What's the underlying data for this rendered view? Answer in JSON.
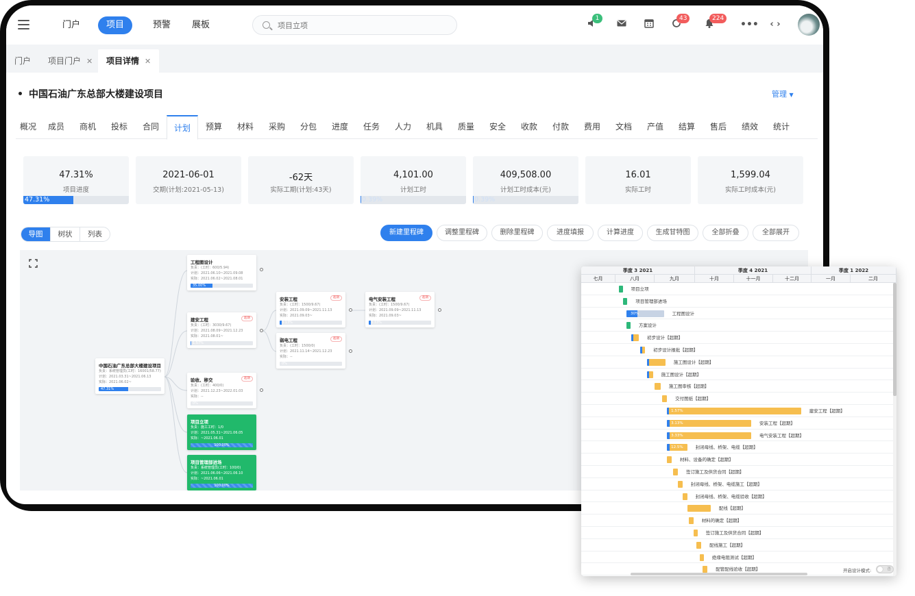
{
  "topbar": {
    "nav": [
      "门户",
      "项目",
      "预警",
      "展板"
    ],
    "search_placeholder": "项目立项",
    "badges": {
      "notice": "1",
      "sync": "43",
      "bell": "224"
    },
    "more_icon": "more-icon",
    "code_icon": "code-icon"
  },
  "page_tabs": [
    {
      "label": "门户",
      "closable": false
    },
    {
      "label": "项目门户",
      "closable": true
    },
    {
      "label": "项目详情",
      "closable": true
    }
  ],
  "project": {
    "title": "中国石油广东总部大楼建设项目",
    "manage_label": "管理"
  },
  "subtabs": [
    "概况",
    "成员",
    "商机",
    "投标",
    "合同",
    "计划",
    "预算",
    "材料",
    "采购",
    "分包",
    "进度",
    "任务",
    "人力",
    "机具",
    "质量",
    "安全",
    "收款",
    "付款",
    "费用",
    "文档",
    "产值",
    "结算",
    "售后",
    "绩效",
    "统计"
  ],
  "active_subtab": "计划",
  "stats": [
    {
      "value": "47.31%",
      "label": "项目进度",
      "progress": 47.31,
      "progress_text": "47.31%"
    },
    {
      "value": "2021-06-01",
      "label": "交期(计划:2021-05-13)"
    },
    {
      "value": "-62天",
      "label": "实际工期(计划:43天)"
    },
    {
      "value": "4,101.00",
      "label": "计划工时",
      "progress": 0.39,
      "progress_text": "0.39%"
    },
    {
      "value": "409,508.00",
      "label": "计划工时成本(元)",
      "progress": 0.39,
      "progress_text": "0.39%"
    },
    {
      "value": "16.01",
      "label": "实际工时"
    },
    {
      "value": "1,599.04",
      "label": "实际工时成本(元)"
    }
  ],
  "view_modes": [
    "导图",
    "树状",
    "列表"
  ],
  "actions": [
    "新建里程碑",
    "调整里程碑",
    "删除里程碑",
    "进度填报",
    "计算进度",
    "生成甘特图",
    "全部折叠",
    "全部展开"
  ],
  "mindmap": {
    "root": {
      "title": "中国石油广东总部大楼建设项目",
      "lines": [
        "负责：系统管理员(工时：16001/58.77)",
        "计划：2021.03.31~2021.06.13",
        "实际：2021.06.02~"
      ],
      "progress": "47.31%",
      "pct": 47.31
    },
    "nodes": [
      {
        "title": "工程图设计",
        "lines": [
          "负责：(工时：600/5.94)",
          "计划：2021.06.10~2021.09.08",
          "实际：2021.06.02~2021.08.01"
        ],
        "progress": "35.00%",
        "pct": 35,
        "tag": ""
      },
      {
        "title": "建安工程",
        "lines": [
          "负责：(工时：3030/9.67)",
          "计划：2021.08.09~2021.12.23",
          "实际：2021.08.01~"
        ],
        "progress": "1.57%",
        "pct": 1.57,
        "tag": "超期"
      },
      {
        "title": "验收、移交",
        "lines": [
          "负责：(工时：400/0)",
          "计划：2021.12.23~2022.01.03",
          "实际：--"
        ],
        "progress": "0%",
        "pct": 0,
        "tag": "超期"
      },
      {
        "title": "安装工程",
        "lines": [
          "负责：(工时：1500/9.67)",
          "计划：2021.09.09~2021.11.13",
          "实际：2021.09.03~"
        ],
        "progress": "3.13%",
        "pct": 3.13,
        "tag": "超期"
      },
      {
        "title": "弱电工程",
        "lines": [
          "负责：(工时：1500/0)",
          "计划：2021.11.14~2021.12.23",
          "实际：--"
        ],
        "progress": "0%",
        "pct": 0,
        "tag": "超期"
      },
      {
        "title": "电气安装工程",
        "lines": [
          "负责：(工时：1500/9.67)",
          "计划：2021.09.09~2021.11.13",
          "实际：2021.09.03~"
        ],
        "progress": "3.33%",
        "pct": 3.33,
        "tag": "超期"
      },
      {
        "title": "项目立项",
        "lines": [
          "负责：施工工时：1/0",
          "计划：2021.05.31~2021.06.05",
          "实际：~2021.06.01"
        ],
        "progress": "100.00%",
        "pct": 100,
        "tag": ""
      },
      {
        "title": "项目管理部进场",
        "lines": [
          "负责：系统管理员(工时：100/0)",
          "计划：2021.06.06~2021.06.10",
          "实际：~2021.06.01"
        ],
        "progress": "100.00%",
        "pct": 100,
        "tag": ""
      }
    ]
  },
  "gantt": {
    "quarters": [
      {
        "label": "季度 3 2021",
        "months": [
          "七月",
          "八月",
          "九月"
        ]
      },
      {
        "label": "季度 4 2021",
        "months": [
          "十月",
          "十一月",
          "十二月"
        ]
      },
      {
        "label": "季度 1 2022",
        "months": [
          "一月",
          "二月"
        ]
      }
    ],
    "tasks": [
      {
        "label": "项目立项",
        "start": 0.12,
        "end": 0.13,
        "color": "#2db87a",
        "progress": ""
      },
      {
        "label": "项目管理部进场",
        "start": 0.135,
        "end": 0.145,
        "color": "#2db87a",
        "progress": ""
      },
      {
        "label": "工程图设计",
        "start": 0.145,
        "end": 0.265,
        "color": "#c7d3e4",
        "progress": "30%",
        "pct": 30
      },
      {
        "label": "方案设计",
        "start": 0.145,
        "end": 0.155,
        "color": "#2db87a",
        "progress": ""
      },
      {
        "label": "初步设计【超期】",
        "start": 0.16,
        "end": 0.185,
        "color": "#f6be4f",
        "progress": "",
        "pct": 10
      },
      {
        "label": "初步设计报批【超期】",
        "start": 0.19,
        "end": 0.205,
        "color": "#f6be4f",
        "progress": "",
        "pct": 20
      },
      {
        "label": "施工图设计【超期】",
        "start": 0.21,
        "end": 0.27,
        "color": "#f6be4f",
        "progress": "",
        "pct": 10
      },
      {
        "label": "施工图设计【超期】",
        "start": 0.21,
        "end": 0.23,
        "color": "#f6be4f",
        "progress": "",
        "pct": 10
      },
      {
        "label": "施工图审核【超期】",
        "start": 0.235,
        "end": 0.255,
        "color": "#f6be4f",
        "progress": ""
      },
      {
        "label": "交付图纸【超期】",
        "start": 0.26,
        "end": 0.275,
        "color": "#f6be4f",
        "progress": ""
      },
      {
        "label": "建安工程【超期】",
        "start": 0.275,
        "end": 0.705,
        "color": "#f6be4f",
        "progress": "1.57%",
        "pct": 1.57
      },
      {
        "label": "安装工程【超期】",
        "start": 0.275,
        "end": 0.545,
        "color": "#f6be4f",
        "progress": "3.13%",
        "pct": 3.13
      },
      {
        "label": "电气安装工程【超期】",
        "start": 0.275,
        "end": 0.545,
        "color": "#f6be4f",
        "progress": "3.33%",
        "pct": 3.33
      },
      {
        "label": "封闭母线、桥架、电缆【超期】",
        "start": 0.275,
        "end": 0.34,
        "color": "#f6be4f",
        "progress": "12.5%",
        "pct": 12.5
      },
      {
        "label": "材料、设备的确定【超期】",
        "start": 0.275,
        "end": 0.29,
        "color": "#f6be4f",
        "progress": ""
      },
      {
        "label": "签订施工及供货合同【超期】",
        "start": 0.295,
        "end": 0.31,
        "color": "#f6be4f",
        "progress": ""
      },
      {
        "label": "封闭母线、桥架、电缆施工【超期】",
        "start": 0.31,
        "end": 0.325,
        "color": "#f6be4f",
        "progress": ""
      },
      {
        "label": "封闭母线、桥架、电缆验收【超期】",
        "start": 0.325,
        "end": 0.34,
        "color": "#f6be4f",
        "progress": ""
      },
      {
        "label": "配线【超期】",
        "start": 0.34,
        "end": 0.415,
        "color": "#f6be4f",
        "progress": ""
      },
      {
        "label": "材料的确定【超期】",
        "start": 0.345,
        "end": 0.36,
        "color": "#f6be4f",
        "progress": ""
      },
      {
        "label": "签订施工及供货合同【超期】",
        "start": 0.36,
        "end": 0.37,
        "color": "#f6be4f",
        "progress": ""
      },
      {
        "label": "配线施工【超期】",
        "start": 0.37,
        "end": 0.385,
        "color": "#f6be4f",
        "progress": ""
      },
      {
        "label": "绝缘电阻测试【超期】",
        "start": 0.38,
        "end": 0.39,
        "color": "#f6be4f",
        "progress": ""
      },
      {
        "label": "配管配线验收【超期】",
        "start": 0.39,
        "end": 0.405,
        "color": "#f6be4f",
        "progress": ""
      }
    ],
    "design_mode_label": "开启设计模式:",
    "design_mode_state": "否"
  }
}
